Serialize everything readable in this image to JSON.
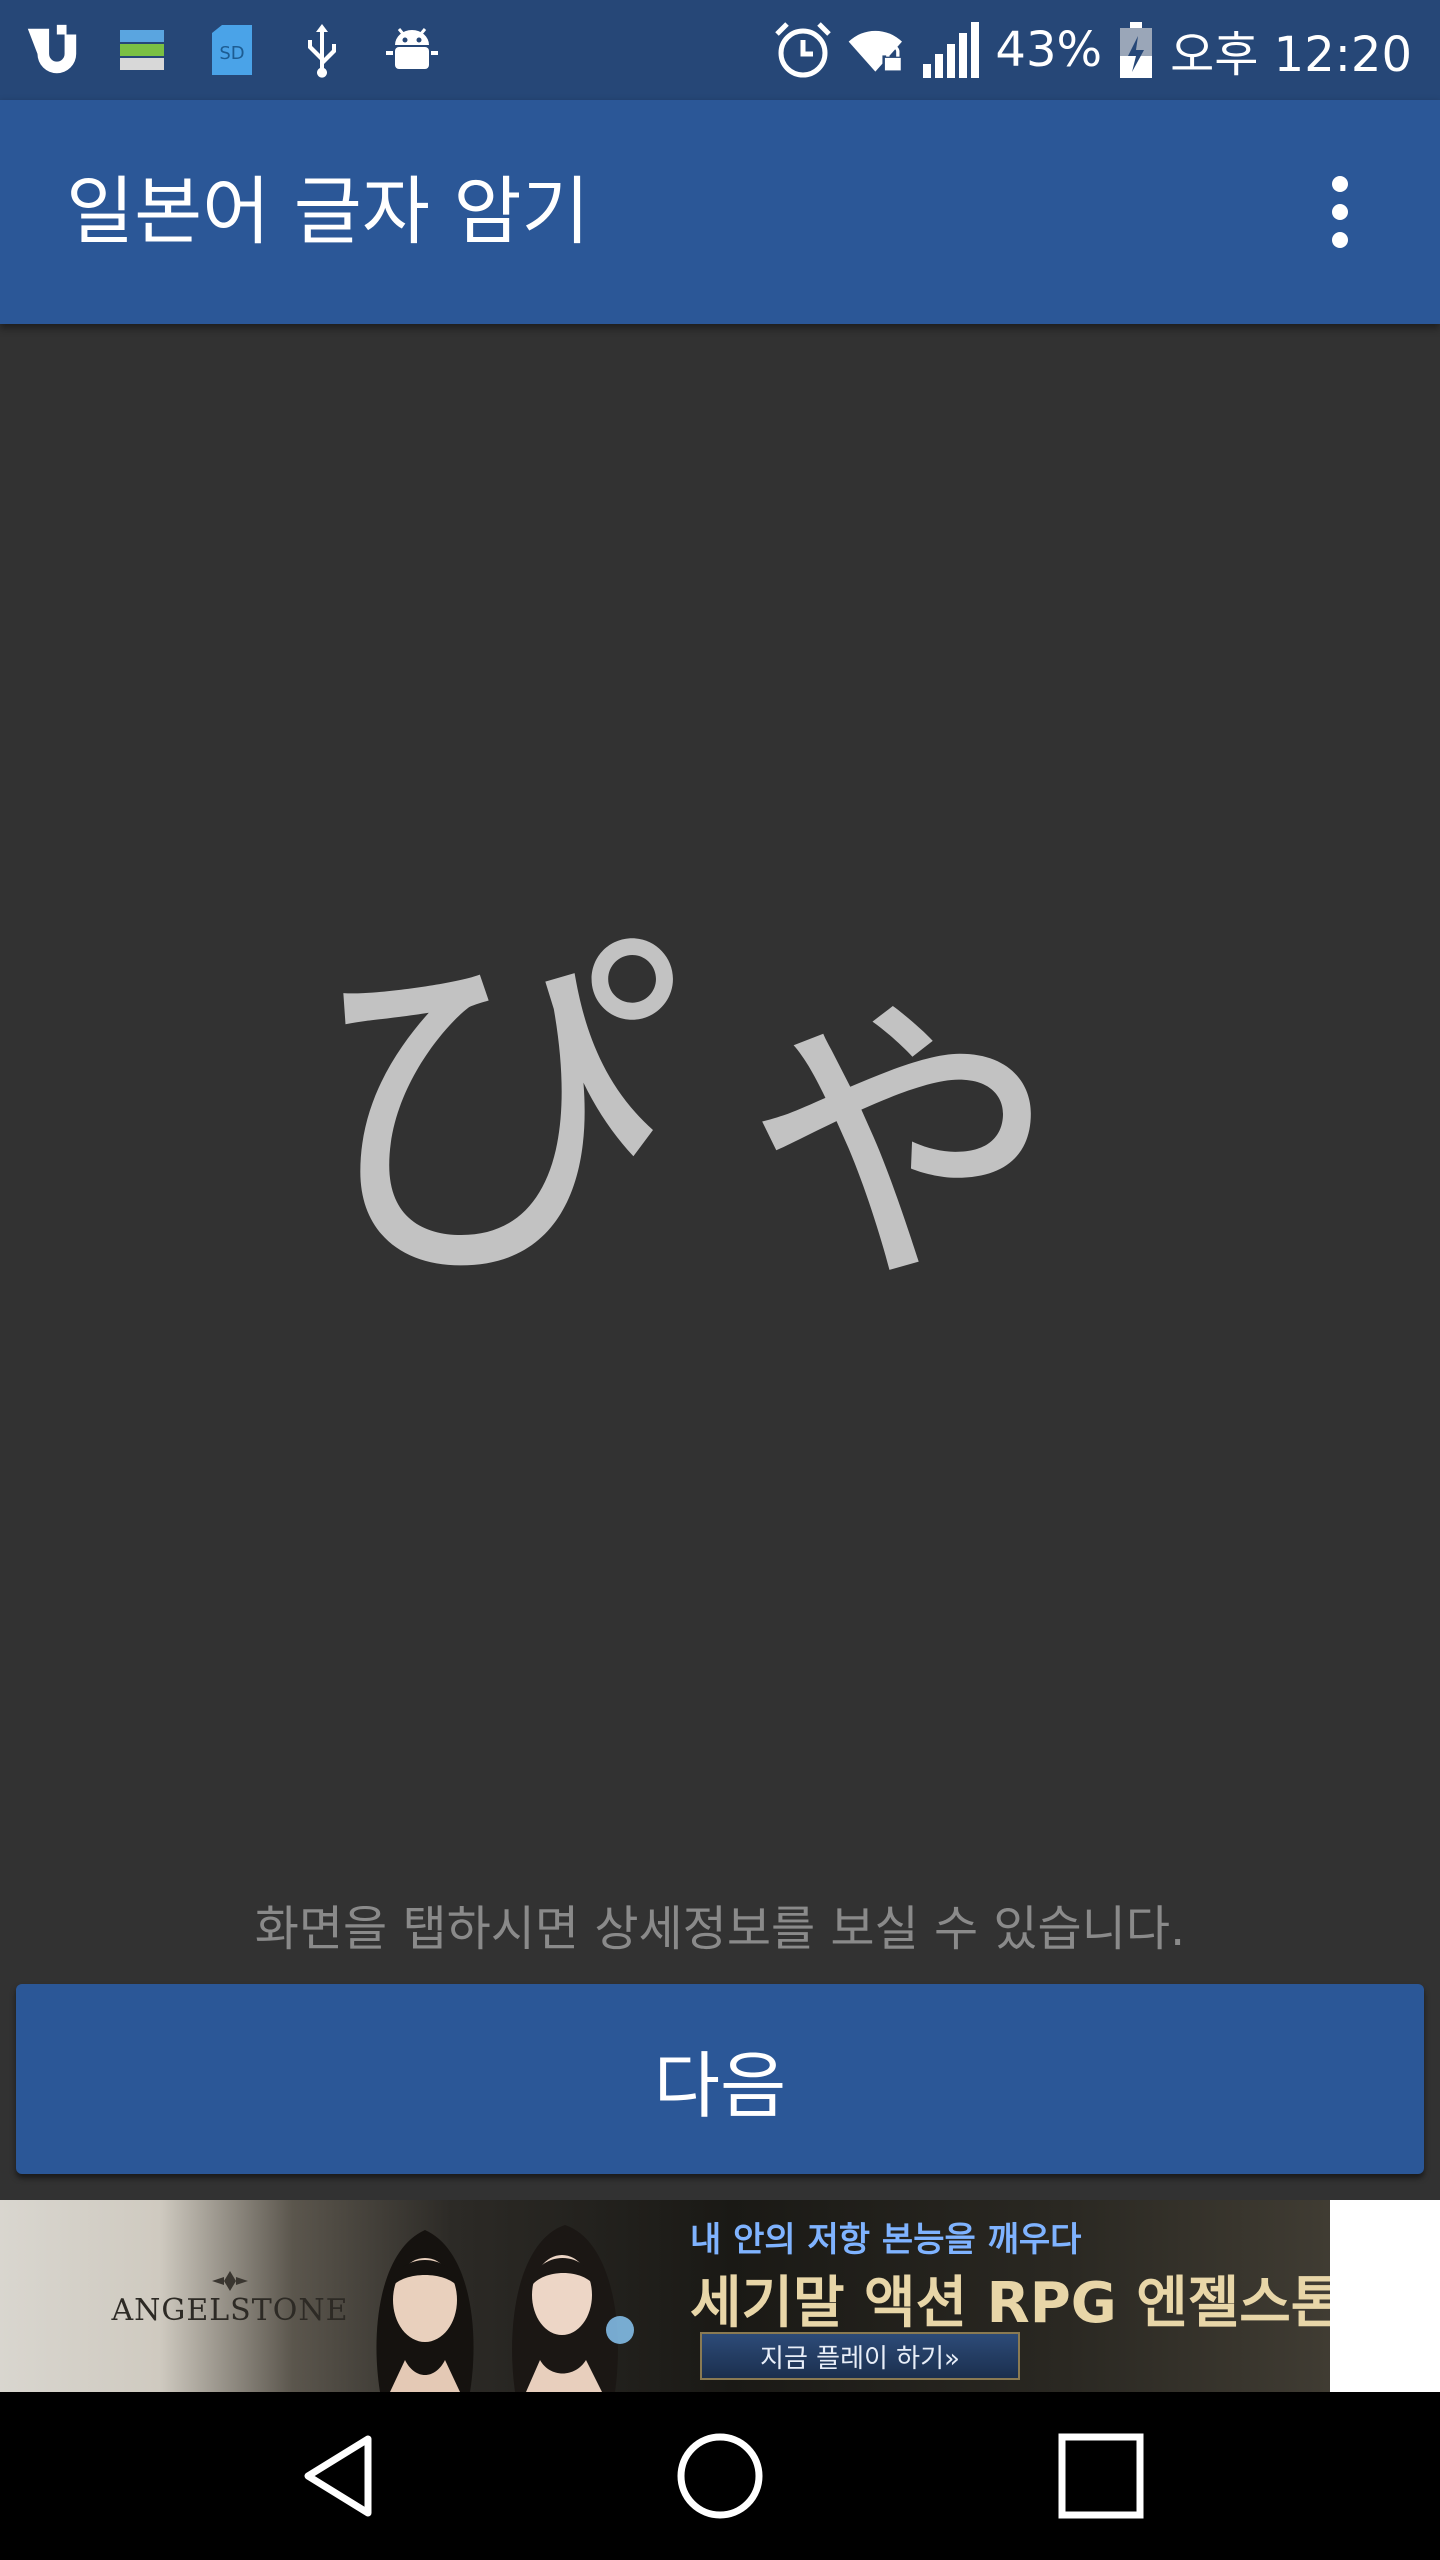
{
  "status_bar": {
    "icons_left": [
      "u-plus-icon",
      "storage-icon",
      "sd-card-icon",
      "usb-icon",
      "android-debug-icon"
    ],
    "icons_right": [
      "alarm-icon",
      "wifi-lock-icon",
      "signal-icon",
      "battery-charging-icon"
    ],
    "battery_percent": "43%",
    "time": "오후 12:20"
  },
  "app_bar": {
    "title": "일본어 글자 암기",
    "menu_icon": "more-vert-icon"
  },
  "main": {
    "character": "ぴゃ",
    "hint": "화면을 탭하시면 상세정보를 보실 수 있습니다.",
    "next_label": "다음"
  },
  "ad": {
    "logo_text": "ANGELSTONE",
    "tagline": "내 안의 저항 본능을 깨우다",
    "headline": "세기말 액션 RPG 엔젤스톤",
    "cta": "지금 플레이 하기»"
  },
  "nav_bar": {
    "icons": [
      "back-icon",
      "home-icon",
      "recents-icon"
    ]
  },
  "colors": {
    "status_bar": "#264777",
    "app_bar": "#2b5797",
    "content_bg": "#323232",
    "character": "#c2c2c2",
    "hint": "#8a8a8a"
  }
}
